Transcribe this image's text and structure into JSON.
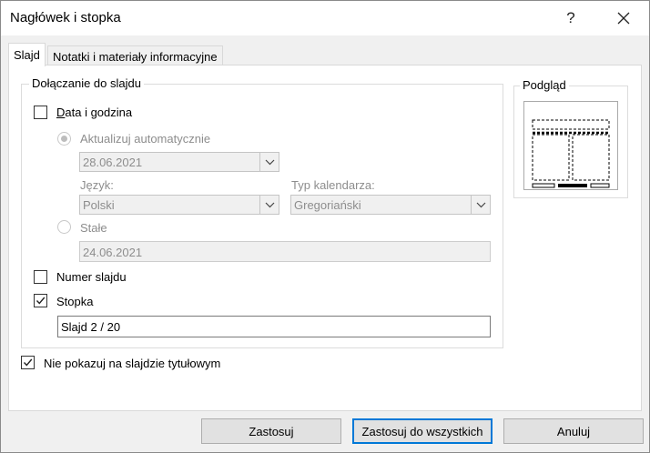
{
  "window": {
    "title": "Nagłówek i stopka",
    "help_glyph": "?",
    "close_glyph": "✕"
  },
  "tabs": [
    {
      "label": "Slajd",
      "active": true
    },
    {
      "label": "Notatki i materiały informacyjne",
      "active": false
    }
  ],
  "include_group": {
    "legend": "Dołączanie do slajdu",
    "date_time": {
      "label": "Data i godzina",
      "checked": false
    },
    "update_auto": {
      "label": "Aktualizuj automatycznie",
      "selected": true,
      "enabled": false
    },
    "auto_date": {
      "value": "28.06.2021"
    },
    "language": {
      "label": "Język:",
      "value": "Polski"
    },
    "calendar": {
      "label": "Typ kalendarza:",
      "value": "Gregoriański"
    },
    "fixed": {
      "label": "Stałe",
      "selected": false,
      "enabled": false
    },
    "fixed_date": {
      "value": "24.06.2021"
    },
    "slide_number": {
      "label": "Numer slajdu",
      "checked": false
    },
    "footer": {
      "label": "Stopka",
      "checked": true
    },
    "footer_text": {
      "value": "Slajd 2 / 20"
    }
  },
  "dont_show_title": {
    "label": "Nie pokazuj na slajdzie tytułowym",
    "checked": true
  },
  "preview": {
    "legend": "Podgląd"
  },
  "buttons": {
    "apply": "Zastosuj",
    "apply_all": "Zastosuj do wszystkich",
    "cancel": "Anuluj"
  },
  "icons": {
    "checkmark": "checkmark-icon",
    "chevron": "chevron-down-icon",
    "help": "help-icon",
    "close": "close-icon"
  }
}
